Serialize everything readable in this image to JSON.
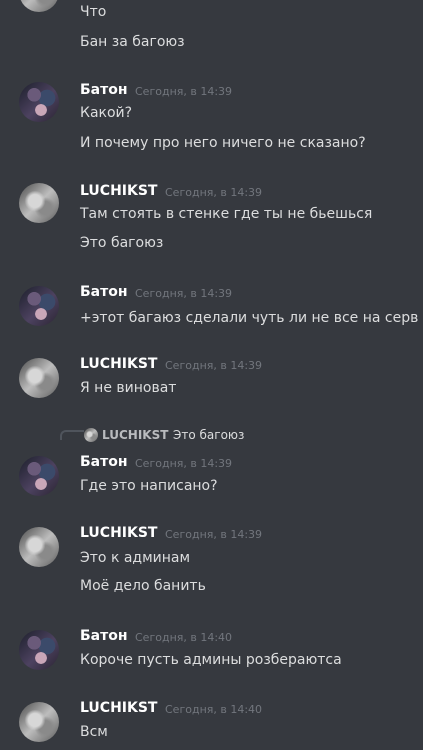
{
  "messages": [
    {
      "author": "",
      "time": "",
      "lines": [
        "Что",
        "Бан за багоюз"
      ]
    },
    {
      "author": "Батон",
      "time": "Сегодня, в 14:39",
      "lines": [
        "Какой?",
        "И почему про него ничего не сказано?"
      ]
    },
    {
      "author": "LUCHIKST",
      "time": "Сегодня, в 14:39",
      "lines": [
        "Там стоять в стенке где ты не бьешься",
        "Это багоюз"
      ]
    },
    {
      "author": "Батон",
      "time": "Сегодня, в 14:39",
      "lines": [
        "+этот багаюз сделали чуть ли не все на серв"
      ]
    },
    {
      "author": "LUCHIKST",
      "time": "Сегодня, в 14:39",
      "lines": [
        "Я не виноват"
      ]
    },
    {
      "author": "Батон",
      "time": "Сегодня, в 14:39",
      "lines": [
        "Где это написано?"
      ],
      "reply": {
        "author": "LUCHIKST",
        "text": "Это багоюз"
      }
    },
    {
      "author": "LUCHIKST",
      "time": "Сегодня, в 14:39",
      "lines": [
        "Это к админам",
        "Моё дело банить"
      ]
    },
    {
      "author": "Батон",
      "time": "Сегодня, в 14:40",
      "lines": [
        "Короче пусть админы розбераютса"
      ]
    },
    {
      "author": "LUCHIKST",
      "time": "Сегодня, в 14:40",
      "lines": [
        "Всм"
      ]
    }
  ]
}
